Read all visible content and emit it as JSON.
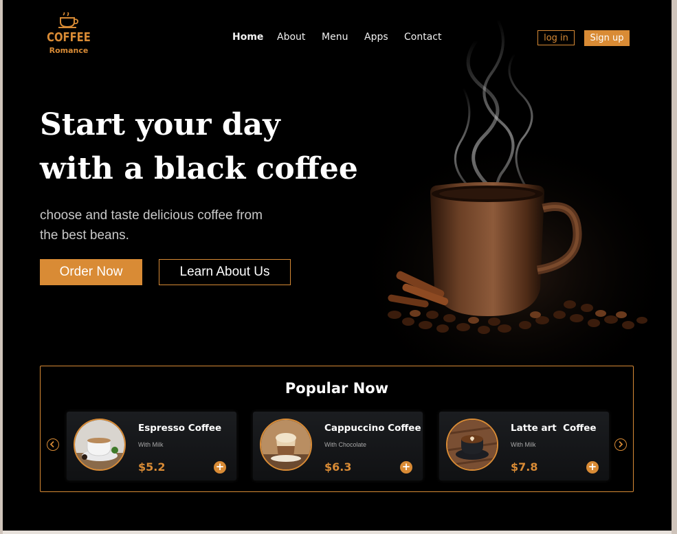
{
  "brand": {
    "logo_word": "COFFEE",
    "logo_sub": "Romance"
  },
  "nav": {
    "items": [
      {
        "label": "Home",
        "active": true
      },
      {
        "label": "About",
        "active": false
      },
      {
        "label": "Menu",
        "active": false
      },
      {
        "label": "Apps",
        "active": false
      },
      {
        "label": "Contact",
        "active": false
      }
    ],
    "login_label": "log in",
    "signup_label": "Sign up"
  },
  "hero": {
    "title_line1": "Start your day",
    "title_line2": "with a black coffee",
    "subtitle_line1": "choose and taste delicious coffee from",
    "subtitle_line2": "the best beans.",
    "order_label": "Order Now",
    "learn_label": "Learn About Us"
  },
  "popular": {
    "title": "Popular Now",
    "prev_icon": "chevron-left-icon",
    "next_icon": "chevron-right-icon",
    "cards": [
      {
        "name": "Espresso Coffee",
        "desc": "With Milk",
        "price": "$5.2",
        "image": "espresso-cup"
      },
      {
        "name": "Cappuccino Coffee",
        "desc": "With Chocolate",
        "price": "$6.3",
        "image": "cappuccino-glass"
      },
      {
        "name": "Latte art  Coffee",
        "desc": "With Milk",
        "price": "$7.8",
        "image": "latte-art-cup"
      }
    ],
    "add_label": "+"
  },
  "colors": {
    "accent": "#d98b35",
    "background": "#000000",
    "text": "#ffffff"
  }
}
